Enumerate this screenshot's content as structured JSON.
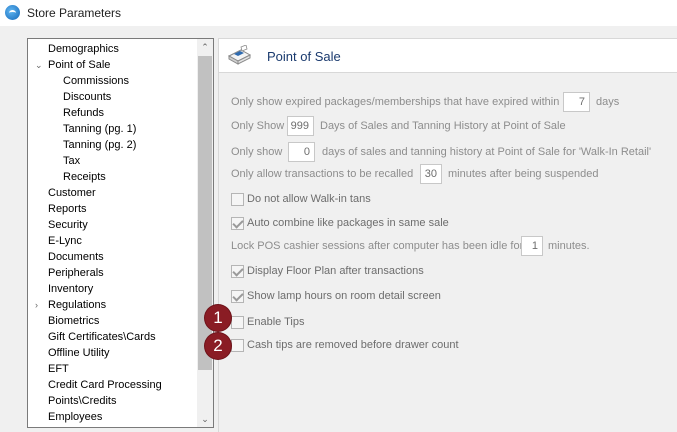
{
  "window": {
    "title": "Store Parameters"
  },
  "tree": {
    "items": [
      {
        "label": "Demographics",
        "level": 0,
        "expander": ""
      },
      {
        "label": "Point of Sale",
        "level": 0,
        "expander": "⌄"
      },
      {
        "label": "Commissions",
        "level": 1,
        "expander": ""
      },
      {
        "label": "Discounts",
        "level": 1,
        "expander": ""
      },
      {
        "label": "Refunds",
        "level": 1,
        "expander": ""
      },
      {
        "label": "Tanning (pg. 1)",
        "level": 1,
        "expander": ""
      },
      {
        "label": "Tanning (pg. 2)",
        "level": 1,
        "expander": ""
      },
      {
        "label": "Tax",
        "level": 1,
        "expander": ""
      },
      {
        "label": "Receipts",
        "level": 1,
        "expander": ""
      },
      {
        "label": "Customer",
        "level": 0,
        "expander": ""
      },
      {
        "label": "Reports",
        "level": 0,
        "expander": ""
      },
      {
        "label": "Security",
        "level": 0,
        "expander": ""
      },
      {
        "label": "E-Lync",
        "level": 0,
        "expander": ""
      },
      {
        "label": "Documents",
        "level": 0,
        "expander": ""
      },
      {
        "label": "Peripherals",
        "level": 0,
        "expander": ""
      },
      {
        "label": "Inventory",
        "level": 0,
        "expander": ""
      },
      {
        "label": "Regulations",
        "level": 0,
        "expander": "›"
      },
      {
        "label": "Biometrics",
        "level": 0,
        "expander": ""
      },
      {
        "label": "Gift Certificates\\Cards",
        "level": 0,
        "expander": ""
      },
      {
        "label": "Offline Utility",
        "level": 0,
        "expander": ""
      },
      {
        "label": "EFT",
        "level": 0,
        "expander": ""
      },
      {
        "label": "Credit Card Processing",
        "level": 0,
        "expander": ""
      },
      {
        "label": "Points\\Credits",
        "level": 0,
        "expander": ""
      },
      {
        "label": "Employees",
        "level": 0,
        "expander": ""
      }
    ],
    "scroll_up": "⌃",
    "scroll_down": "⌄"
  },
  "section": {
    "title": "Point of Sale",
    "icon": "cash-register-icon"
  },
  "settings": {
    "expired_prefix": "Only show expired packages/memberships that have expired within",
    "expired_value": "7",
    "expired_suffix": "days",
    "history_prefix": "Only Show",
    "history_value": "999",
    "history_suffix": "Days of Sales and Tanning History at Point of Sale",
    "walkin_prefix": "Only show",
    "walkin_value": "0",
    "walkin_suffix": "days of sales and tanning history at Point of Sale for 'Walk-In Retail'",
    "recall_prefix": "Only allow transactions to be recalled",
    "recall_value": "30",
    "recall_suffix": "minutes after being suspended",
    "no_walkin_tans": {
      "label": "Do not allow Walk-in tans",
      "checked": false
    },
    "auto_combine": {
      "label": "Auto combine like packages in same sale",
      "checked": true
    },
    "lock_prefix": "Lock POS cashier sessions after computer has been idle for",
    "lock_value": "1",
    "lock_suffix": "minutes.",
    "floor_plan": {
      "label": "Display Floor Plan after transactions",
      "checked": true
    },
    "lamp_hours": {
      "label": "Show lamp hours on room detail screen",
      "checked": true
    },
    "enable_tips": {
      "label": "Enable Tips",
      "checked": false
    },
    "cash_tips": {
      "label": "Cash tips are removed before drawer count",
      "checked": false
    }
  },
  "annotations": {
    "badge1": "1",
    "badge2": "2",
    "color": "#8a1c24"
  }
}
